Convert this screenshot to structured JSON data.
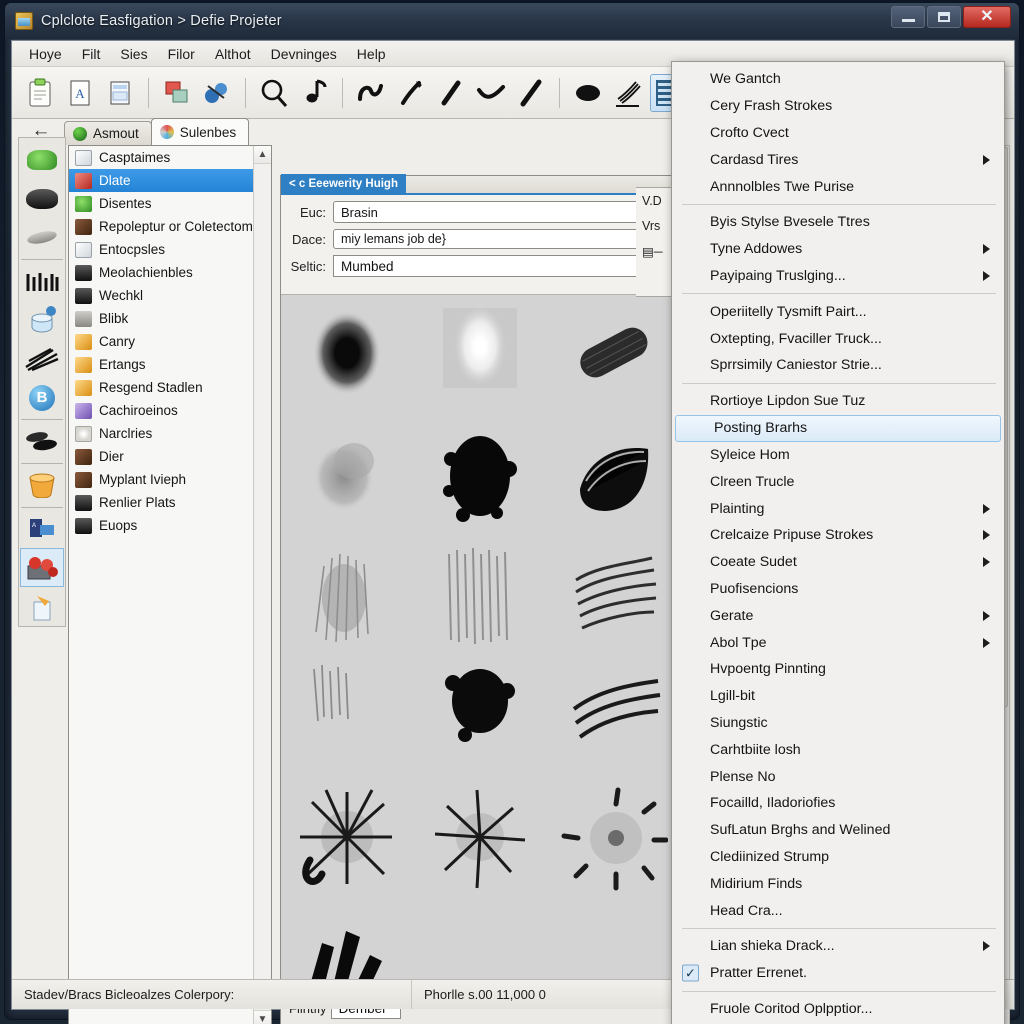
{
  "window": {
    "title": "Cplclote Easfigation > Defie Projeter",
    "icon": "folder-image-icon",
    "buttons": {
      "minimize": "minimize-button",
      "maximize": "maximize-button",
      "close": "close-button"
    }
  },
  "menubar": {
    "items": [
      {
        "label": "Hoye"
      },
      {
        "label": "Filt"
      },
      {
        "label": "Sies"
      },
      {
        "label": "Filor"
      },
      {
        "label": "Althot"
      },
      {
        "label": "Devninges"
      },
      {
        "label": "Help"
      }
    ]
  },
  "toolbar": {
    "buttons": [
      {
        "name": "clipboard-icon"
      },
      {
        "name": "document-script-icon"
      },
      {
        "name": "pages-icon"
      },
      {
        "name": "layers-icon"
      },
      {
        "name": "palette-icon"
      },
      {
        "name": "zoom-icon"
      },
      {
        "name": "note-icon"
      },
      {
        "name": "squiggle-icon"
      },
      {
        "name": "pen-icon"
      },
      {
        "name": "pencil-icon"
      },
      {
        "name": "curve-icon"
      },
      {
        "name": "slash-icon"
      },
      {
        "name": "blob-icon"
      },
      {
        "name": "rake-icon"
      },
      {
        "name": "bars-icon"
      }
    ]
  },
  "tabs": {
    "back": "←",
    "items": [
      {
        "label": "Asmout",
        "icon": "globe-green-icon",
        "active": false
      },
      {
        "label": "Sulenbes",
        "icon": "palette-color-icon",
        "active": true
      }
    ]
  },
  "vertical_tools": [
    {
      "name": "splatter-green-tool",
      "icon": "ic-green",
      "selected": false
    },
    {
      "name": "blob-black-tool",
      "icon": "ic-dark",
      "selected": false
    },
    {
      "name": "smudge-oils-tool",
      "icon": "ic-gray",
      "selected": false
    },
    {
      "name": "comb-tool",
      "icon": "ic-dark",
      "selected": false
    },
    {
      "name": "jar-tool",
      "icon": "ic-blue",
      "selected": false
    },
    {
      "name": "scratch-tool",
      "icon": "ic-dark",
      "selected": false
    },
    {
      "name": "blender-b-tool",
      "icon": "ic-blue",
      "selected": false
    },
    {
      "name": "sponge-tool",
      "icon": "ic-dark",
      "selected": false
    },
    {
      "name": "bucket-tool",
      "icon": "ic-orange",
      "selected": false
    },
    {
      "name": "stamp-tool",
      "icon": "ic-blue",
      "selected": false
    },
    {
      "name": "toolbox-tool",
      "icon": "ic-red",
      "selected": true
    },
    {
      "name": "cup-tool",
      "icon": "ic-orange",
      "selected": false
    }
  ],
  "list_panel": {
    "items": [
      {
        "label": "Casptaimes",
        "icon": "ic-paper",
        "selected": false
      },
      {
        "label": "Dlate",
        "icon": "ic-red",
        "selected": true
      },
      {
        "label": "Disentes",
        "icon": "ic-green",
        "selected": false
      },
      {
        "label": "Repoleptur or Coletectom",
        "icon": "ic-photo",
        "selected": false
      },
      {
        "label": "Entocpsles",
        "icon": "ic-paper",
        "selected": false
      },
      {
        "label": "Meolachienbles",
        "icon": "ic-dark",
        "selected": false
      },
      {
        "label": "Wechkl",
        "icon": "ic-dark",
        "selected": false
      },
      {
        "label": "Blibk",
        "icon": "ic-gray",
        "selected": false
      },
      {
        "label": "Canry",
        "icon": "ic-orange",
        "selected": false
      },
      {
        "label": "Ertangs",
        "icon": "ic-orange",
        "selected": false
      },
      {
        "label": "Resgend Stadlen",
        "icon": "ic-orange",
        "selected": false
      },
      {
        "label": "Cachiroeinos",
        "icon": "ic-purple",
        "selected": false
      },
      {
        "label": "Narclries",
        "icon": "ic-star",
        "selected": false
      },
      {
        "label": "Dier",
        "icon": "ic-photo",
        "selected": false
      },
      {
        "label": "Myplant Ivieph",
        "icon": "ic-photo",
        "selected": false
      },
      {
        "label": "Renlier Plats",
        "icon": "ic-dark",
        "selected": false
      },
      {
        "label": "Euops",
        "icon": "ic-dark",
        "selected": false
      }
    ],
    "scroll_up": "▲",
    "scroll_down": "▼"
  },
  "center_panel": {
    "tab_label": "< c Eeewerity Huigh",
    "fields": [
      {
        "label": "Euc:",
        "value": "Brasin",
        "type": "combo"
      },
      {
        "label": "Dace:",
        "value": "miy lemans job de}",
        "type": "combo-small",
        "plus": "+"
      },
      {
        "label": "Seltic:",
        "value": "Mumbed",
        "type": "text",
        "plus": "+"
      }
    ],
    "footer": {
      "label": "Flintfiy",
      "value": "Dember"
    }
  },
  "right_sliver": {
    "lines": [
      "V.D",
      "Vrs",
      "▤─"
    ]
  },
  "context_menu": {
    "items": [
      {
        "label": "We Gantch",
        "submenu": false,
        "checked": false
      },
      {
        "label": "Cery Frash Strokes",
        "submenu": false,
        "checked": false
      },
      {
        "label": "Crofto Cvect",
        "submenu": false,
        "checked": false
      },
      {
        "label": "Cardasd Tires",
        "submenu": true,
        "checked": false
      },
      {
        "label": "Annnolbles Twe Purise",
        "submenu": false,
        "checked": false
      },
      {
        "separator": true
      },
      {
        "label": "Byis Stylse Bvesele Ttres",
        "submenu": false,
        "checked": false
      },
      {
        "label": "Tyne Addowes",
        "submenu": true,
        "checked": false
      },
      {
        "label": "Payipaing Truslging...",
        "submenu": true,
        "checked": false
      },
      {
        "separator": true
      },
      {
        "label": "Operiitelly Tysmift Pairt...",
        "submenu": false,
        "checked": false
      },
      {
        "label": "Oxtepting, Fvaciller Truck...",
        "submenu": false,
        "checked": false
      },
      {
        "label": "Sprrsimily Caniestor Strie...",
        "submenu": false,
        "checked": false
      },
      {
        "separator": true
      },
      {
        "label": "Rortioye Lipdon Sue Tuz",
        "submenu": false,
        "checked": false
      },
      {
        "label": "Posting Brarhs",
        "submenu": false,
        "checked": false,
        "selected": true
      },
      {
        "label": "Syleice Hom",
        "submenu": false,
        "checked": false
      },
      {
        "label": "Clreen Trucle",
        "submenu": false,
        "checked": false
      },
      {
        "label": "Plainting",
        "submenu": true,
        "checked": false
      },
      {
        "label": "Crelcaize Pripuse Strokes",
        "submenu": true,
        "checked": false
      },
      {
        "label": "Coeate Sudet",
        "submenu": true,
        "checked": false
      },
      {
        "label": "Puofisencions",
        "submenu": false,
        "checked": false
      },
      {
        "label": "Gerate",
        "submenu": true,
        "checked": false
      },
      {
        "label": "Abol Tpe",
        "submenu": true,
        "checked": false
      },
      {
        "label": "Hvpoentg Pinnting",
        "submenu": false,
        "checked": false
      },
      {
        "label": "Lgill-bit",
        "submenu": false,
        "checked": false
      },
      {
        "label": "Siungstic",
        "submenu": false,
        "checked": false
      },
      {
        "label": "Carhtbiite losh",
        "submenu": false,
        "checked": false
      },
      {
        "label": "Plense No",
        "submenu": false,
        "checked": false
      },
      {
        "label": "Focailld, Iladoriofies",
        "submenu": false,
        "checked": false
      },
      {
        "label": "SufLatun Brghs and Welined",
        "submenu": false,
        "checked": false
      },
      {
        "label": "Clediinized Strump",
        "submenu": false,
        "checked": false
      },
      {
        "label": "Midirium Finds",
        "submenu": false,
        "checked": false
      },
      {
        "label": "Head Cra...",
        "submenu": false,
        "checked": false
      },
      {
        "separator": true
      },
      {
        "label": "Lian shieka Drack...",
        "submenu": true,
        "checked": false
      },
      {
        "label": "Pratter Errenet.",
        "submenu": false,
        "checked": true,
        "check_glyph": "✓"
      },
      {
        "separator": true
      },
      {
        "label": "Fruole Coritod Oplpptior...",
        "submenu": false,
        "checked": false
      }
    ]
  },
  "statusbar": {
    "left": "Stadev/Bracs Bicleoalzes Colerpory:",
    "right": "Phorlle s.00 11,000 0"
  },
  "colors": {
    "accent_blue": "#2684d6",
    "menu_bg": "#f1f0ee",
    "panel_bg": "#f2f1ee",
    "swatch_bg": "#d3d3d3",
    "selection_blue": "#96c4e6",
    "close_red": "#b4281f"
  }
}
